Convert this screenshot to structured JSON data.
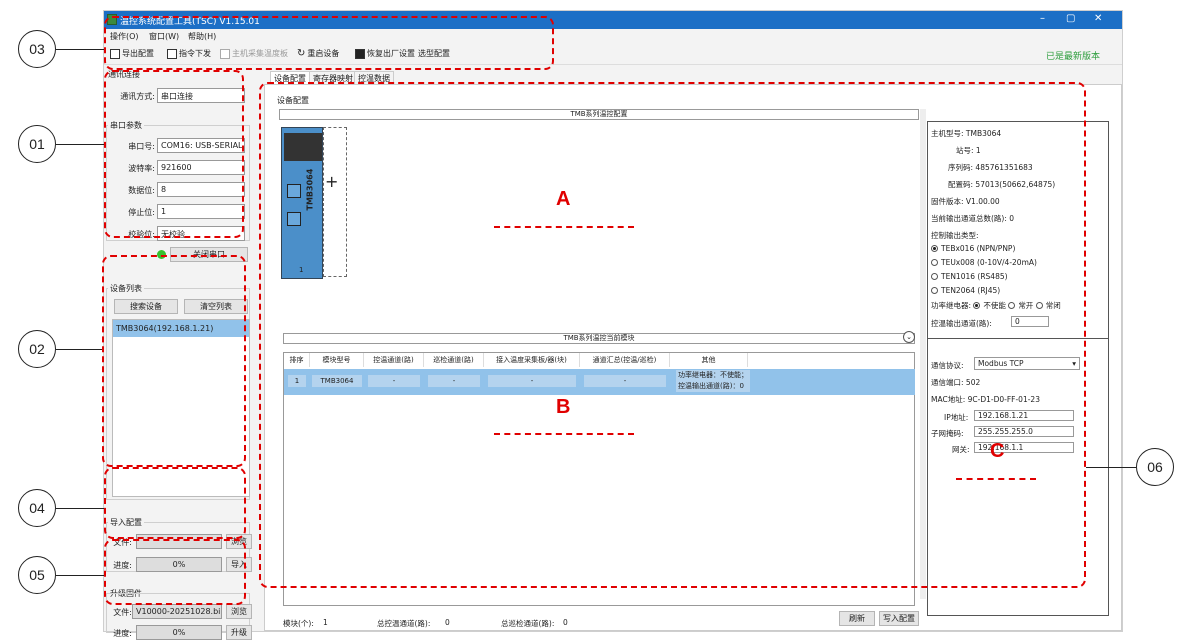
{
  "window": {
    "title": "温控系统配置工具(TSC) V1.15.01"
  },
  "menu": [
    "操作(O)",
    "窗口(W)",
    "帮助(H)"
  ],
  "toolbar": {
    "export": "导出配置",
    "command": "指令下发",
    "board": "主机采集温度板",
    "restart": "重启设备",
    "factory": "恢复出厂设置",
    "select": "选型配置",
    "latest": "已是最新版本"
  },
  "comm": {
    "group": "通讯连接",
    "mode_label": "通讯方式:",
    "mode": "串口连接"
  },
  "serial": {
    "group": "串口参数",
    "port_label": "串口号:",
    "port": "COM16: USB-SERIAL",
    "baud_label": "波特率:",
    "baud": "921600",
    "data_label": "数据位:",
    "data": "8",
    "stop_label": "停止位:",
    "stop": "1",
    "parity_label": "校验位:",
    "parity": "无校验",
    "close_btn": "关闭串口"
  },
  "devices": {
    "group": "设备列表",
    "search_btn": "搜索设备",
    "clear_btn": "清空列表",
    "items": [
      "TMB3064(192.168.1.21)"
    ]
  },
  "import": {
    "group": "导入配置",
    "file_label": "文件:",
    "file": "",
    "browse": "浏览",
    "progress_label": "进度:",
    "progress": "0%",
    "import_btn": "导入"
  },
  "upgrade": {
    "group": "升级固件",
    "file_label": "文件:",
    "file": "V10000-20251028.bin",
    "browse": "浏览",
    "progress_label": "进度:",
    "progress": "0%",
    "upgrade_btn": "升级"
  },
  "tabs": [
    "设备配置",
    "寄存器映射",
    "控温数据"
  ],
  "device_cfg": {
    "group": "设备配置",
    "top_title": "TMB系列温控配置",
    "module_model": "TMB3064",
    "slot": "1",
    "plus": "+"
  },
  "module_table": {
    "title": "TMB系列温控当前模块",
    "headers": [
      "排序",
      "模块型号",
      "控温通道(路)",
      "巡检通道(路)",
      "接入温度采集板/器(块)",
      "通道汇总(控温/巡检)",
      "其他"
    ],
    "rows": [
      {
        "index": "1",
        "model": "TMB3064",
        "c1": "-",
        "c2": "-",
        "c3": "-",
        "c4": "-",
        "other1": "功率继电器：不使能；",
        "other2": "控温输出通道(路)：0"
      }
    ]
  },
  "footer": {
    "modules_label": "模块(个):",
    "modules": "1",
    "ctrl_label": "总控温通道(路):",
    "ctrl": "0",
    "patrol_label": "总巡检通道(路):",
    "patrol": "0",
    "refresh": "刷新",
    "write": "写入配置"
  },
  "info": {
    "model_label": "主机型号:",
    "model": "TMB3064",
    "station_label": "站号:",
    "station": "1",
    "serial_label": "序列码:",
    "serial": "485761351683",
    "config_label": "配置码:",
    "config": "57013(50662,64875)",
    "fw_label": "固件版本:",
    "fw": "V1.00.00",
    "out_total_label": "当前输出通道总数(路):",
    "out_total": "0",
    "out_type_label": "控制输出类型:",
    "types": [
      "TEBx016 (NPN/PNP)",
      "TEUx008 (0-10V/4-20mA)",
      "TEN1016 (RS485)",
      "TEN2064 (RJ45)"
    ],
    "relay_label": "功率继电器:",
    "relay_opts": [
      "不使能",
      "常开",
      "常闭"
    ],
    "ctrl_out_label": "控温输出通道(路):",
    "ctrl_out": "0",
    "proto_label": "通信协议:",
    "proto": "Modbus TCP",
    "port_label": "通信端口:",
    "port": "502",
    "mac_label": "MAC地址:",
    "mac": "9C-D1-D0-FF-01-23",
    "ip_label": "IP地址:",
    "ip": "192.168.1.21",
    "mask_label": "子网掩码:",
    "mask": "255.255.255.0",
    "gw_label": "网关:",
    "gw": "192.168.1.1"
  },
  "annotations": {
    "c01": "01",
    "c02": "02",
    "c03": "03",
    "c04": "04",
    "c05": "05",
    "c06": "06",
    "A": "A",
    "B": "B",
    "C": "C"
  }
}
